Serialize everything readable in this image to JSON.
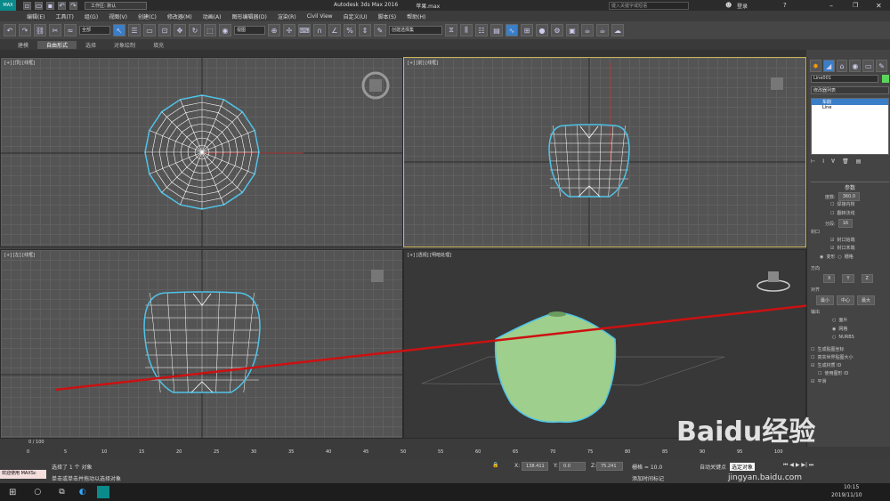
{
  "title": {
    "app": "Autodesk 3ds Max 2016",
    "file": "苹果.max",
    "workspace": "工作区: 默认",
    "search_placeholder": "键入关键字或短语",
    "login": "登录"
  },
  "menu": [
    "编辑(E)",
    "工具(T)",
    "组(G)",
    "视图(V)",
    "创建(C)",
    "修改器(M)",
    "动画(A)",
    "图形编辑器(D)",
    "渲染(R)",
    "Civil View",
    "自定义(U)",
    "脚本(S)",
    "帮助(H)"
  ],
  "toolbar": {
    "selection_filter": "全部",
    "ref_coord": "视图",
    "named_selection": "创建选择集"
  },
  "ribbon": [
    "建模",
    "自由形式",
    "选择",
    "对象绘制",
    "填充"
  ],
  "viewports": {
    "top": "[+] [顶] [线框]",
    "front": "[+] [前] [线框]",
    "left": "[+] [左] [线框]",
    "persp": "[+] [透视] [明暗处理]"
  },
  "panel": {
    "object_name": "Line001",
    "modifier_list": "修改器列表",
    "stack": [
      "车削",
      "Line"
    ],
    "rollout": "参数",
    "degrees_label": "度数:",
    "degrees_value": "360.0",
    "weld_core": "焊接内核",
    "flip_normals": "翻转法线",
    "segments_label": "分段:",
    "segments_value": "16",
    "capping": "封口",
    "cap_start": "封口始端",
    "cap_end": "封口末端",
    "morph": "变形",
    "grid": "栅格",
    "direction": "方向",
    "x": "X",
    "y": "Y",
    "z": "Z",
    "align": "对齐",
    "min": "最小",
    "center": "中心",
    "max": "最大",
    "output": "输出",
    "patch": "面片",
    "mesh": "网格",
    "nurbs": "NURBS",
    "gen_map": "生成贴图坐标",
    "real_world": "真实世界贴图大小",
    "gen_mat": "生成材质 ID",
    "use_shape": "使用图形 ID",
    "smooth": "平滑"
  },
  "timeline": {
    "frame": "0 / 100",
    "ticks": [
      "0",
      "5",
      "10",
      "15",
      "20",
      "25",
      "30",
      "35",
      "40",
      "45",
      "50",
      "55",
      "60",
      "65",
      "70",
      "75",
      "80",
      "85",
      "90",
      "95",
      "100"
    ]
  },
  "status": {
    "welcome": "欢迎使用 MAXSc",
    "selected": "选择了 1 个 对象",
    "hint": "单击或单击并拖动以选择对象",
    "x": "138.411",
    "y": "0.0",
    "z": "75.241",
    "grid": "栅格 = 10.0",
    "add_tag": "添加时间标记",
    "autokey": "自动关键点",
    "set_key": "选定对象"
  },
  "taskbar": {
    "time": "10:15",
    "date": "2019/11/10"
  },
  "watermark": "Baidu经验",
  "watermark_url": "jingyan.baidu.com",
  "colors": {
    "accent": "#c8c8c8",
    "arrow": "#cc1111",
    "apple": "#9ecf8c",
    "wire": "#ffffff",
    "select": "#4fc3e8"
  }
}
